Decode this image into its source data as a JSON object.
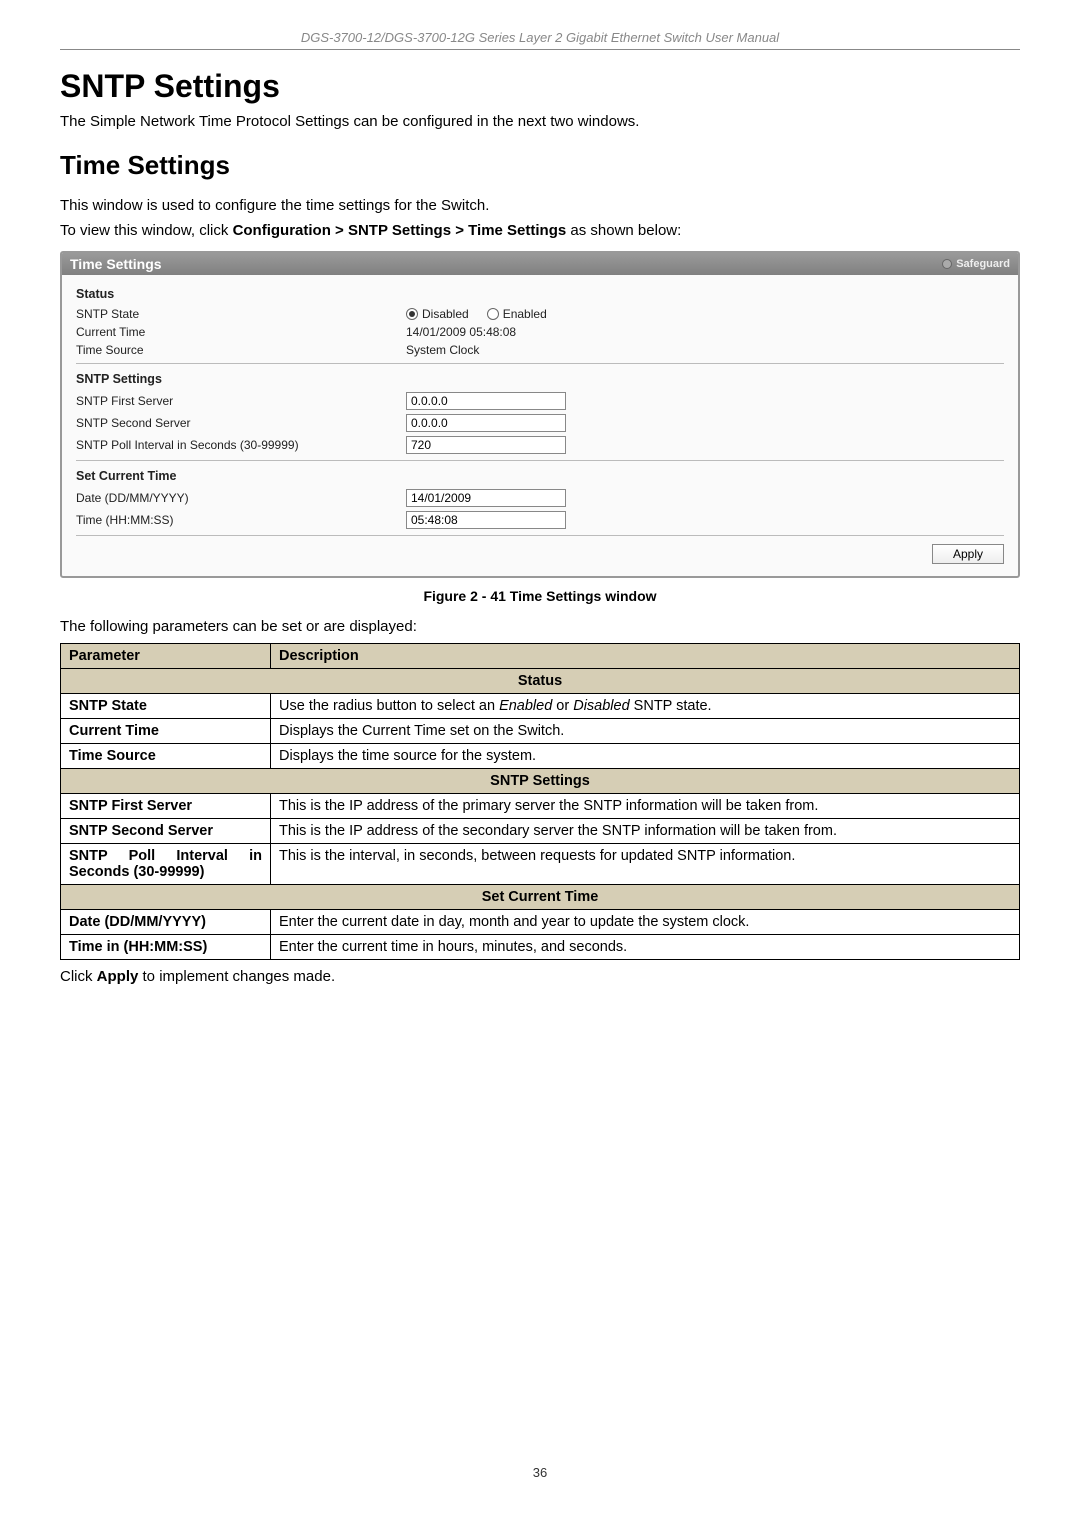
{
  "header": "DGS-3700-12/DGS-3700-12G Series Layer 2 Gigabit Ethernet Switch User Manual",
  "main_heading": "SNTP Settings",
  "intro": "The Simple Network Time Protocol Settings can be configured in the next two windows.",
  "sub_heading": "Time Settings",
  "desc1": "This window is used to configure the time settings for the Switch.",
  "nav_prefix": "To view this window, click ",
  "nav_bold": "Configuration > SNTP Settings > Time Settings",
  "nav_suffix": " as shown below:",
  "ui": {
    "title": "Time Settings",
    "safeguard": "Safeguard",
    "status": {
      "heading": "Status",
      "sntp_state_label": "SNTP State",
      "disabled": "Disabled",
      "enabled": "Enabled",
      "current_time_label": "Current Time",
      "current_time_value": "14/01/2009 05:48:08",
      "time_source_label": "Time Source",
      "time_source_value": "System Clock"
    },
    "sntp": {
      "heading": "SNTP Settings",
      "first_server_label": "SNTP First Server",
      "first_server_value": "0.0.0.0",
      "second_server_label": "SNTP Second Server",
      "second_server_value": "0.0.0.0",
      "poll_interval_label": "SNTP Poll Interval in Seconds  (30-99999)",
      "poll_interval_value": "720"
    },
    "set_time": {
      "heading": "Set Current Time",
      "date_label": "Date (DD/MM/YYYY)",
      "date_value": "14/01/2009",
      "time_label": "Time (HH:MM:SS)",
      "time_value": "05:48:08"
    },
    "apply_button": "Apply"
  },
  "figure_caption": "Figure 2 - 41 Time Settings window",
  "params_intro": "The following parameters can be set or are displayed:",
  "table": {
    "col_parameter": "Parameter",
    "col_description": "Description",
    "section_status": "Status",
    "row_sntp_state_p": "SNTP State",
    "row_sntp_state_d_pre": "Use the radius button to select an ",
    "row_sntp_state_d_i1": "Enabled",
    "row_sntp_state_d_mid": " or ",
    "row_sntp_state_d_i2": "Disabled",
    "row_sntp_state_d_post": " SNTP state.",
    "row_current_time_p": "Current Time",
    "row_current_time_d": "Displays the Current Time set on the Switch.",
    "row_time_source_p": "Time Source",
    "row_time_source_d": "Displays the time source for the system.",
    "section_sntp": "SNTP Settings",
    "row_first_server_p": "SNTP First Server",
    "row_first_server_d": "This is the IP address of the primary server the SNTP information will be taken from.",
    "row_second_server_p": "SNTP Second Server",
    "row_second_server_d": "This is the IP address of the secondary server the SNTP information will be taken from.",
    "row_poll_p": "SNTP Poll Interval in Seconds (30-99999)",
    "row_poll_d": "This is the interval, in seconds, between requests for updated SNTP information.",
    "section_set_time": "Set Current Time",
    "row_date_p": "Date (DD/MM/YYYY)",
    "row_date_d": "Enter the current date in day, month and year to update the system clock.",
    "row_time_p": "Time in (HH:MM:SS)",
    "row_time_d": "Enter the current time in hours, minutes, and seconds."
  },
  "apply_note_pre": "Click ",
  "apply_note_bold": "Apply",
  "apply_note_post": " to implement changes made.",
  "page_number": "36"
}
